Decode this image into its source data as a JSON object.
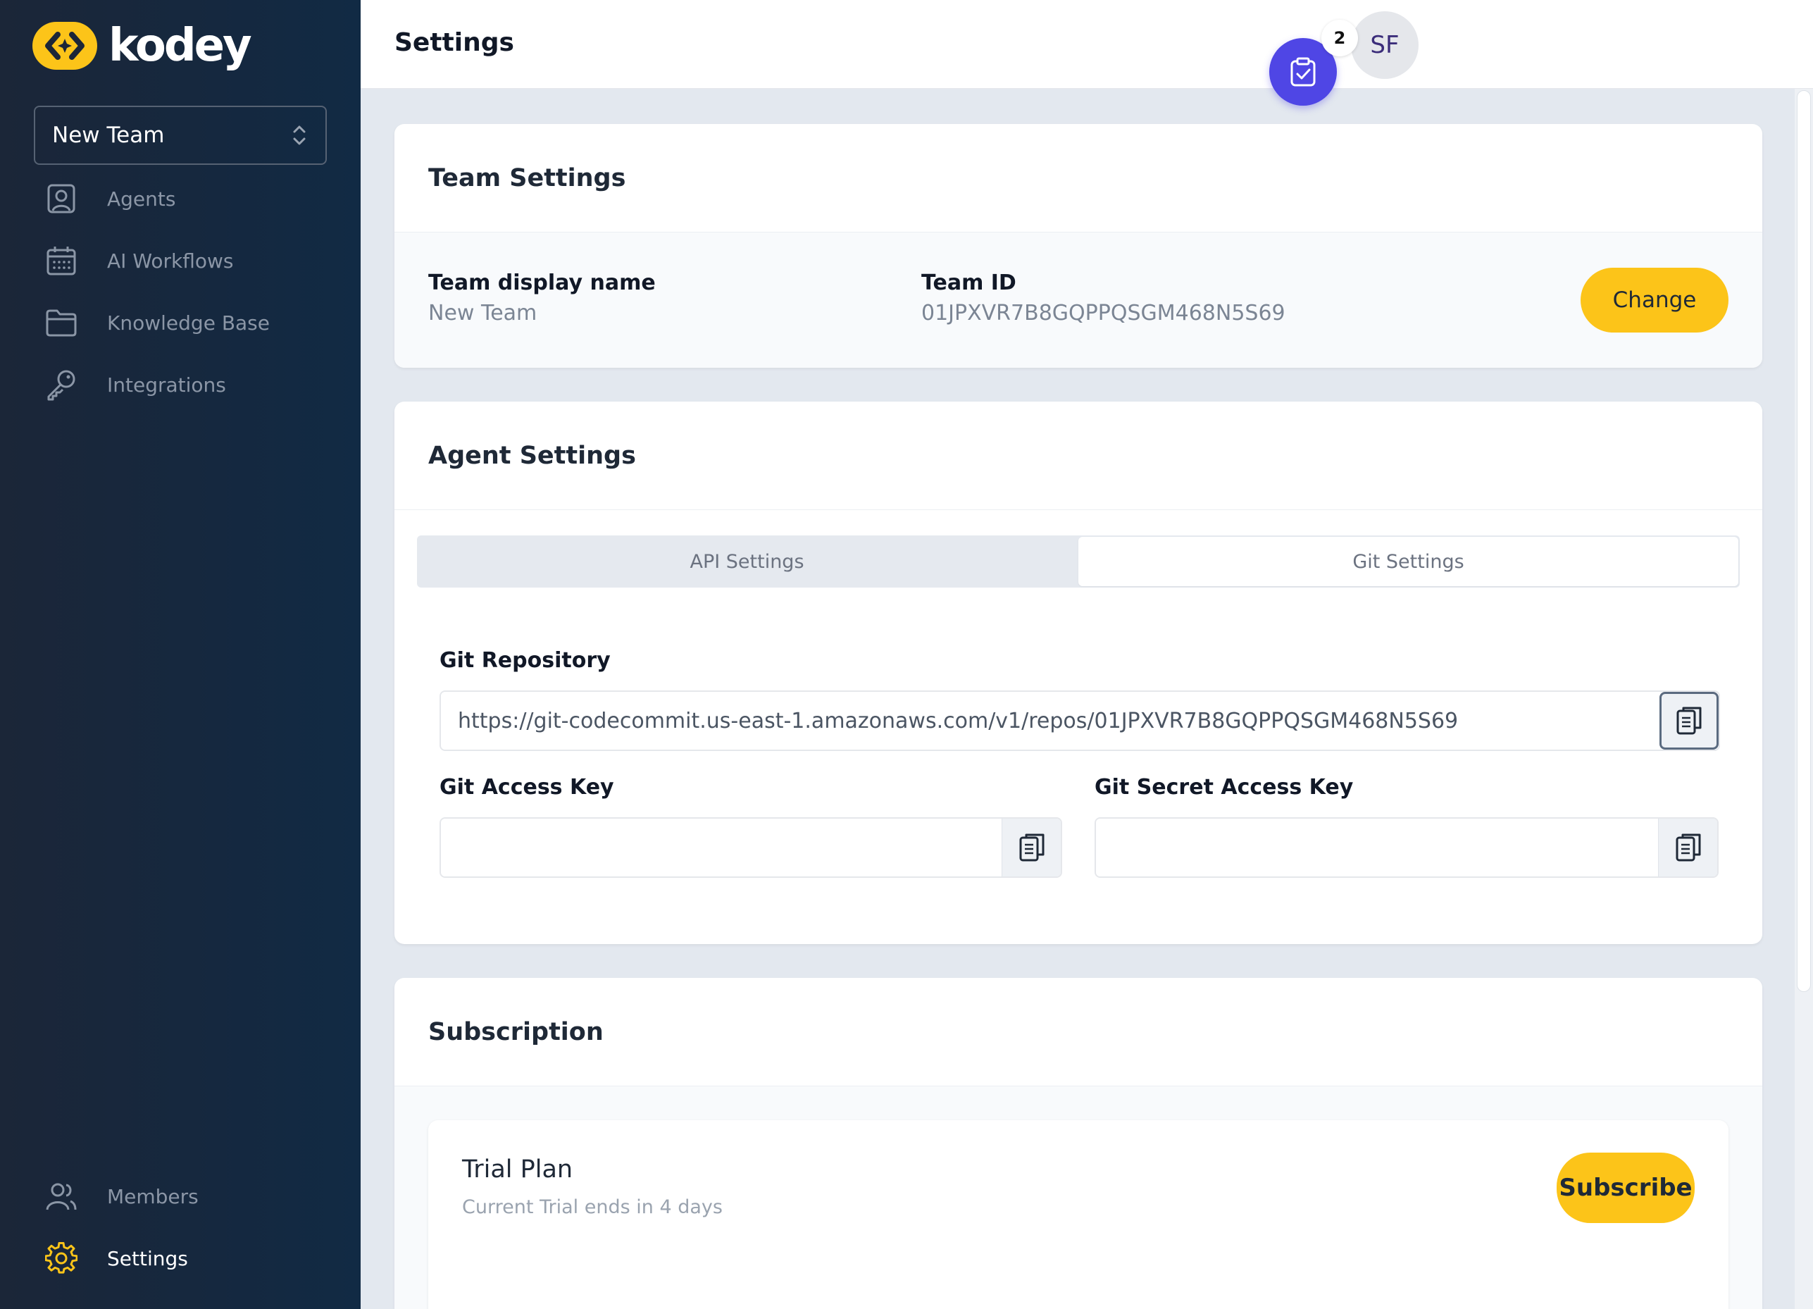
{
  "brand": {
    "name": "kodey",
    "accent": "#fcc419",
    "sidebar_bg": "#152a40"
  },
  "sidebar": {
    "team_selector": "New Team",
    "items": [
      {
        "label": "Agents",
        "icon": "user-square-icon"
      },
      {
        "label": "AI Workflows",
        "icon": "calendar-icon"
      },
      {
        "label": "Knowledge Base",
        "icon": "folder-icon"
      },
      {
        "label": "Integrations",
        "icon": "key-icon"
      }
    ],
    "bottom_items": [
      {
        "label": "Members",
        "icon": "users-icon"
      },
      {
        "label": "Settings",
        "icon": "gear-icon",
        "active": true
      }
    ]
  },
  "header": {
    "title": "Settings",
    "task_badge_count": "2",
    "avatar_initials": "SF"
  },
  "team_settings": {
    "title": "Team Settings",
    "display_name_label": "Team display name",
    "display_name_value": "New Team",
    "team_id_label": "Team ID",
    "team_id_value": "01JPXVR7B8GQPPQSGM468N5S69",
    "change_label": "Change"
  },
  "agent_settings": {
    "title": "Agent Settings",
    "tabs": [
      {
        "label": "API Settings",
        "active": false
      },
      {
        "label": "Git Settings",
        "active": true
      }
    ],
    "git_repository_label": "Git Repository",
    "git_repository_value": "https://git-codecommit.us-east-1.amazonaws.com/v1/repos/01JPXVR7B8GQPPQSGM468N5S69",
    "git_access_key_label": "Git Access Key",
    "git_access_key_value": "",
    "git_secret_access_key_label": "Git Secret Access Key",
    "git_secret_access_key_value": ""
  },
  "subscription": {
    "title": "Subscription",
    "plan_name": "Trial Plan",
    "plan_status": "Current Trial ends in 4 days",
    "subscribe_label": "Subscribe"
  }
}
